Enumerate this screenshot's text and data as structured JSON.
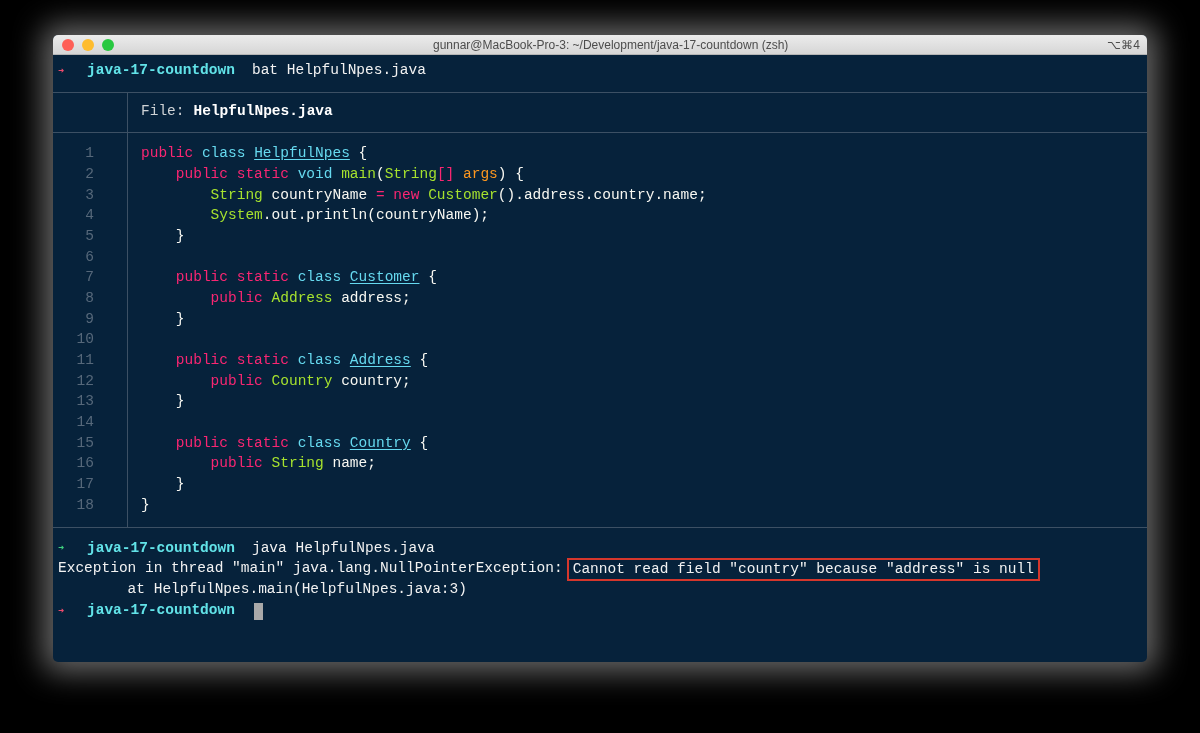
{
  "title_bar": {
    "title": "gunnar@MacBook-Pro-3: ~/Development/java-17-countdown (zsh)",
    "shortcut": "⌥⌘4"
  },
  "session": [
    {
      "kind": "prompt",
      "arrow": "➜",
      "color": "#ee4a6c",
      "directory": "java-17-countdown",
      "command": "bat HelpfulNpes.java",
      "cursor": false
    },
    {
      "kind": "file_view",
      "header_label": "File:",
      "file_name": "HelpfulNpes.java",
      "lines": [
        {
          "number": "1",
          "tokens": [
            {
              "kind": "keyword",
              "text": "public "
            },
            {
              "kind": "storage",
              "text": "class "
            },
            {
              "kind": "name",
              "text": "HelpfulNpes"
            },
            {
              "kind": "plain",
              "text": " {"
            }
          ]
        },
        {
          "number": "2",
          "tokens": [
            {
              "kind": "keyword",
              "text": "    public static "
            },
            {
              "kind": "storage",
              "text": "void "
            },
            {
              "kind": "type",
              "text": "main"
            },
            {
              "kind": "plain",
              "text": "("
            },
            {
              "kind": "type",
              "text": "String"
            },
            {
              "kind": "keyword",
              "text": "[] "
            },
            {
              "kind": "param",
              "text": "args"
            },
            {
              "kind": "plain",
              "text": ") {"
            }
          ]
        },
        {
          "number": "3",
          "tokens": [
            {
              "kind": "type",
              "text": "        String"
            },
            {
              "kind": "plain",
              "text": " countryName "
            },
            {
              "kind": "keyword",
              "text": "= new "
            },
            {
              "kind": "type",
              "text": "Customer"
            },
            {
              "kind": "plain",
              "text": "().address.country.name;"
            }
          ]
        },
        {
          "number": "4",
          "tokens": [
            {
              "kind": "type",
              "text": "        System"
            },
            {
              "kind": "plain",
              "text": ".out.println(countryName);"
            }
          ]
        },
        {
          "number": "5",
          "tokens": [
            {
              "kind": "plain",
              "text": "    }"
            }
          ]
        },
        {
          "number": "6"
        },
        {
          "number": "7",
          "tokens": [
            {
              "kind": "keyword",
              "text": "    public static "
            },
            {
              "kind": "storage",
              "text": "class "
            },
            {
              "kind": "name",
              "text": "Customer"
            },
            {
              "kind": "plain",
              "text": " {"
            }
          ]
        },
        {
          "number": "8",
          "tokens": [
            {
              "kind": "keyword",
              "text": "        public "
            },
            {
              "kind": "type",
              "text": "Address"
            },
            {
              "kind": "plain",
              "text": " address;"
            }
          ]
        },
        {
          "number": "9",
          "tokens": [
            {
              "kind": "plain",
              "text": "    }"
            }
          ]
        },
        {
          "number": "10"
        },
        {
          "number": "11",
          "tokens": [
            {
              "kind": "keyword",
              "text": "    public static "
            },
            {
              "kind": "storage",
              "text": "class "
            },
            {
              "kind": "name",
              "text": "Address"
            },
            {
              "kind": "plain",
              "text": " {"
            }
          ]
        },
        {
          "number": "12",
          "tokens": [
            {
              "kind": "keyword",
              "text": "        public "
            },
            {
              "kind": "type",
              "text": "Country"
            },
            {
              "kind": "plain",
              "text": " country;"
            }
          ]
        },
        {
          "number": "13",
          "tokens": [
            {
              "kind": "plain",
              "text": "    }"
            }
          ]
        },
        {
          "number": "14"
        },
        {
          "number": "15",
          "tokens": [
            {
              "kind": "keyword",
              "text": "    public static "
            },
            {
              "kind": "storage",
              "text": "class "
            },
            {
              "kind": "name",
              "text": "Country"
            },
            {
              "kind": "plain",
              "text": " {"
            }
          ]
        },
        {
          "number": "16",
          "tokens": [
            {
              "kind": "keyword",
              "text": "        public "
            },
            {
              "kind": "type",
              "text": "String"
            },
            {
              "kind": "plain",
              "text": " name;"
            }
          ]
        },
        {
          "number": "17",
          "tokens": [
            {
              "kind": "plain",
              "text": "    }"
            }
          ]
        },
        {
          "number": "18",
          "tokens": [
            {
              "kind": "plain",
              "text": "}"
            }
          ]
        }
      ]
    },
    {
      "kind": "prompt",
      "arrow": "➜",
      "color": "#3fd17f",
      "directory": "java-17-countdown",
      "command": "java HelpfulNpes.java",
      "cursor": false
    },
    {
      "kind": "output",
      "text": "Exception in thread \"main\" java.lang.NullPointerException:",
      "highlight": "Cannot read field \"country\" because \"address\" is null"
    },
    {
      "kind": "output",
      "text": "        at HelpfulNpes.main(HelpfulNpes.java:3)"
    },
    {
      "kind": "prompt",
      "arrow": "➜",
      "color": "#ee4a6c",
      "directory": "java-17-countdown",
      "cursor": true
    }
  ]
}
